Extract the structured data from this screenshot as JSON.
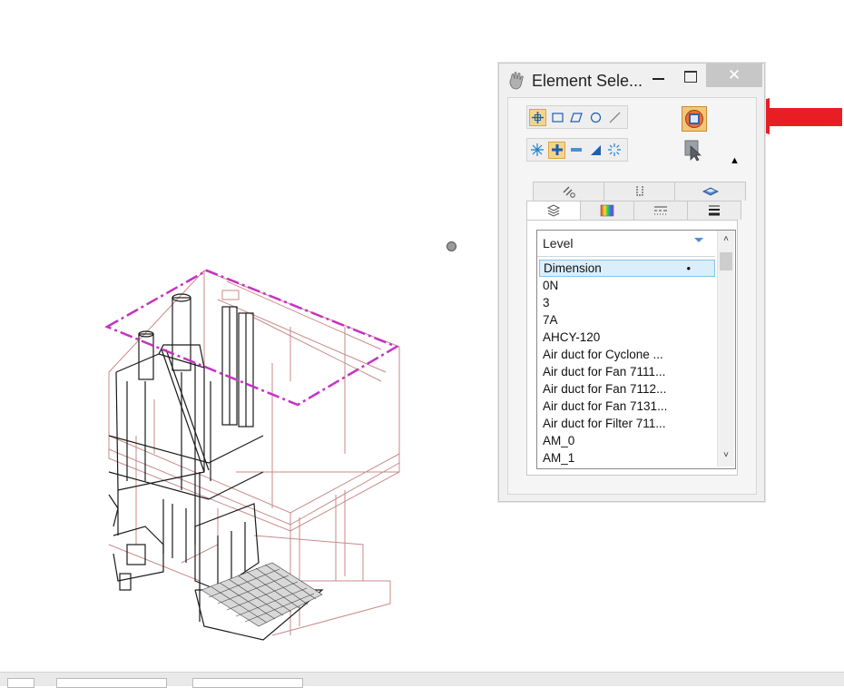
{
  "dialog": {
    "title": "Element Sele...",
    "close_glyph": "✕",
    "icon": "hand-icon"
  },
  "toolbar": {
    "method_tools": [
      "individual-icon",
      "block-icon",
      "shape-icon",
      "circle-icon",
      "line-icon"
    ],
    "mode_tools": [
      "new-icon",
      "add-icon",
      "subtract-icon",
      "invert-icon",
      "clear-icon"
    ],
    "select_all_icon": "select-all-icon",
    "pointer_icon": "element-selection-pointer-icon",
    "expand_glyph": "▲"
  },
  "tabs": {
    "row1": [
      "tab-attributes-icon",
      "tab-types-icon",
      "tab-views-icon"
    ],
    "row2": [
      "tab-levels-icon",
      "tab-colors-icon",
      "tab-styles-icon",
      "tab-weights-icon"
    ],
    "row1_glyphs": [
      "⟋ₒ",
      "⌊⌋",
      "▤"
    ],
    "row2_glyphs": [
      "≋",
      "▦",
      "≡",
      "☰"
    ]
  },
  "level_list": {
    "header": "Level",
    "selected_marker": "•",
    "items": [
      "Dimension",
      "0N",
      "3",
      "7A",
      "AHCY-120",
      "Air duct for Cyclone ...",
      "Air duct for Fan 7111...",
      "Air duct for Fan 7112...",
      "Air duct for Fan 7131...",
      "Air duct for Filter 711...",
      "AM_0",
      "AM_1"
    ],
    "selected_index": 0,
    "scroll_up": "˄",
    "scroll_down": "˅"
  },
  "colors": {
    "fence": "#c433c4",
    "arrow": "#e81e24",
    "selection": "#dbeefb"
  }
}
